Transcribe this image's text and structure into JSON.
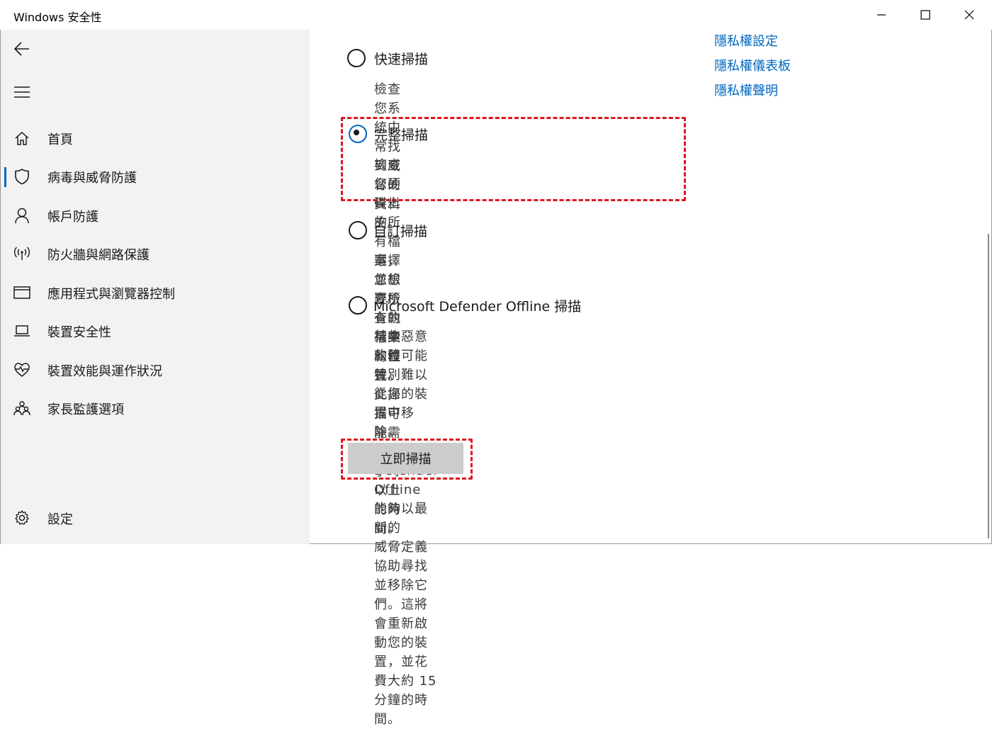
{
  "window": {
    "title": "Windows 安全性",
    "controls": [
      "minimize-icon",
      "maximize-icon",
      "close-icon"
    ]
  },
  "sidebar": {
    "back_icon": "back-arrow-icon",
    "menu_icon": "hamburger-menu-icon",
    "items": [
      {
        "label": "首頁",
        "icon": "home-icon"
      },
      {
        "label": "病毒與威脅防護",
        "icon": "shield-icon",
        "active": true
      },
      {
        "label": "帳戶防護",
        "icon": "person-icon"
      },
      {
        "label": "防火牆與網路保護",
        "icon": "wifi-antenna-icon"
      },
      {
        "label": "應用程式與瀏覽器控制",
        "icon": "browser-window-icon"
      },
      {
        "label": "裝置安全性",
        "icon": "laptop-icon"
      },
      {
        "label": "裝置效能與運作狀況",
        "icon": "heart-pulse-icon"
      },
      {
        "label": "家長監護選項",
        "icon": "family-icon"
      }
    ],
    "settings": {
      "label": "設定",
      "icon": "gear-icon"
    }
  },
  "scan_options": [
    {
      "label": "快速掃描",
      "desc": [
        "檢查您系統中常找到威脅的資料夾。"
      ],
      "selected": false
    },
    {
      "label": "完整掃描",
      "desc": [
        "檢查您硬碟上的所有檔案，並檢查所有執行中",
        "的程式。此掃描可能需要一小時以上的時間。"
      ],
      "selected": true
    },
    {
      "label": "自訂掃描",
      "desc": [
        "選擇您想要檢查的檔案和位置。"
      ],
      "selected": false
    },
    {
      "label": "Microsoft Defender Offline 掃描",
      "desc": [
        "某些惡意軟體可能特別難以從您的裝置中移",
        "除。Microsoft Defender Offline 能夠以最新的",
        "威脅定義協助尋找並移除它們。這將會重新啟",
        "動您的裝置，並花費大約 15 分鐘的時間。"
      ],
      "selected": false
    }
  ],
  "scan_button": {
    "label": "立即掃描"
  },
  "privacy_links": [
    "隱私權設定",
    "隱私權儀表板",
    "隱私權聲明"
  ],
  "colors": {
    "accent": "#0067c0",
    "highlight": "#e0151d",
    "sidebar_bg": "#f2f2f2",
    "button_bg": "#cccccc"
  }
}
